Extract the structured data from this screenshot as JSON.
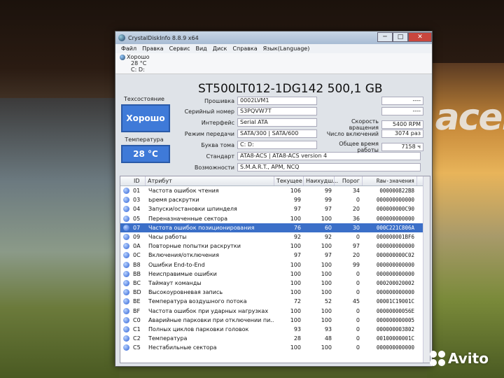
{
  "window": {
    "title": "CrystalDiskInfo 8.8.9 x64",
    "min_label": "─",
    "max_label": "□",
    "close_label": "✕"
  },
  "menu": [
    "Файл",
    "Правка",
    "Сервис",
    "Вид",
    "Диск",
    "Справка",
    "Язык(Language)"
  ],
  "status": {
    "health": "Хорошо",
    "temp": "28 °C",
    "drive": "C: D:"
  },
  "drive_title": "ST500LT012-1DG142 500,1 GB",
  "left_panel": {
    "health_label": "Техсостояние",
    "health_value": "Хорошо",
    "temp_label": "Температура",
    "temp_value": "28 °C"
  },
  "info": {
    "firmware": {
      "label": "Прошивка",
      "value": "0002LVM1"
    },
    "serial": {
      "label": "Серийный номер",
      "value": "S3PQVW7T"
    },
    "interface": {
      "label": "Интерфейс",
      "value": "Serial ATA"
    },
    "transfer": {
      "label": "Режим передачи",
      "value": "SATA/300 | SATA/600"
    },
    "volume": {
      "label": "Буква тома",
      "value": "C: D:"
    },
    "standard": {
      "label": "Стандарт",
      "value": "ATA8-ACS | ATA8-ACS version 4"
    },
    "features": {
      "label": "Возможности",
      "value": "S.M.A.R.T., APM, NCQ"
    }
  },
  "right_info": {
    "blank1": "----",
    "blank2": "----",
    "rotation": {
      "label": "Скорость вращения",
      "value": "5400 RPM"
    },
    "power_count": {
      "label": "Число включений",
      "value": "3074 раз"
    },
    "power_hours": {
      "label": "Общее время работы",
      "value": "7158 ч"
    }
  },
  "table": {
    "headers": {
      "id": "ID",
      "attr": "Атрибут",
      "cur": "Текущее",
      "worst": "Наихудш...",
      "thr": "Порог",
      "raw": "Raw-значения"
    },
    "rows": [
      {
        "id": "01",
        "attr": "Частота ошибок чтения",
        "cur": "106",
        "worst": "99",
        "thr": "34",
        "raw": "000000822B8"
      },
      {
        "id": "03",
        "attr": "Время раскрутки",
        "cur": "99",
        "worst": "99",
        "thr": "0",
        "raw": "000000000000"
      },
      {
        "id": "04",
        "attr": "Запуски/остановки шпинделя",
        "cur": "97",
        "worst": "97",
        "thr": "20",
        "raw": "000000000C90"
      },
      {
        "id": "05",
        "attr": "Переназначенные сектора",
        "cur": "100",
        "worst": "100",
        "thr": "36",
        "raw": "000000000000"
      },
      {
        "id": "07",
        "attr": "Частота ошибок позиционирования",
        "cur": "76",
        "worst": "60",
        "thr": "30",
        "raw": "000C221C806A"
      },
      {
        "id": "09",
        "attr": "Часы работы",
        "cur": "92",
        "worst": "92",
        "thr": "0",
        "raw": "000000001BF6"
      },
      {
        "id": "0A",
        "attr": "Повторные попытки раскрутки",
        "cur": "100",
        "worst": "100",
        "thr": "97",
        "raw": "000000000000"
      },
      {
        "id": "0C",
        "attr": "Включения/отключения",
        "cur": "97",
        "worst": "97",
        "thr": "20",
        "raw": "000000000C02"
      },
      {
        "id": "B8",
        "attr": "Ошибки End-to-End",
        "cur": "100",
        "worst": "100",
        "thr": "99",
        "raw": "000000000000"
      },
      {
        "id": "BB",
        "attr": "Неисправимые ошибки",
        "cur": "100",
        "worst": "100",
        "thr": "0",
        "raw": "000000000000"
      },
      {
        "id": "BC",
        "attr": "Таймаут команды",
        "cur": "100",
        "worst": "100",
        "thr": "0",
        "raw": "000200020002"
      },
      {
        "id": "BD",
        "attr": "Высокоуровневая запись",
        "cur": "100",
        "worst": "100",
        "thr": "0",
        "raw": "000000000000"
      },
      {
        "id": "BE",
        "attr": "Температура воздушного потока",
        "cur": "72",
        "worst": "52",
        "thr": "45",
        "raw": "00001C19001C"
      },
      {
        "id": "BF",
        "attr": "Частота ошибок при ударных нагрузках",
        "cur": "100",
        "worst": "100",
        "thr": "0",
        "raw": "00000000056E"
      },
      {
        "id": "C0",
        "attr": "Аварийные парковки при отключении пи...",
        "cur": "100",
        "worst": "100",
        "thr": "0",
        "raw": "000000000005"
      },
      {
        "id": "C1",
        "attr": "Полных циклов парковки головок",
        "cur": "93",
        "worst": "93",
        "thr": "0",
        "raw": "000000003802"
      },
      {
        "id": "C2",
        "attr": "Температура",
        "cur": "28",
        "worst": "48",
        "thr": "0",
        "raw": "00100000001C"
      },
      {
        "id": "C5",
        "attr": "Нестабильные сектора",
        "cur": "100",
        "worst": "100",
        "thr": "0",
        "raw": "000000000000"
      }
    ],
    "selected_index": 4
  },
  "wallpaper": {
    "brand": "acer",
    "watermark": "Avito"
  }
}
